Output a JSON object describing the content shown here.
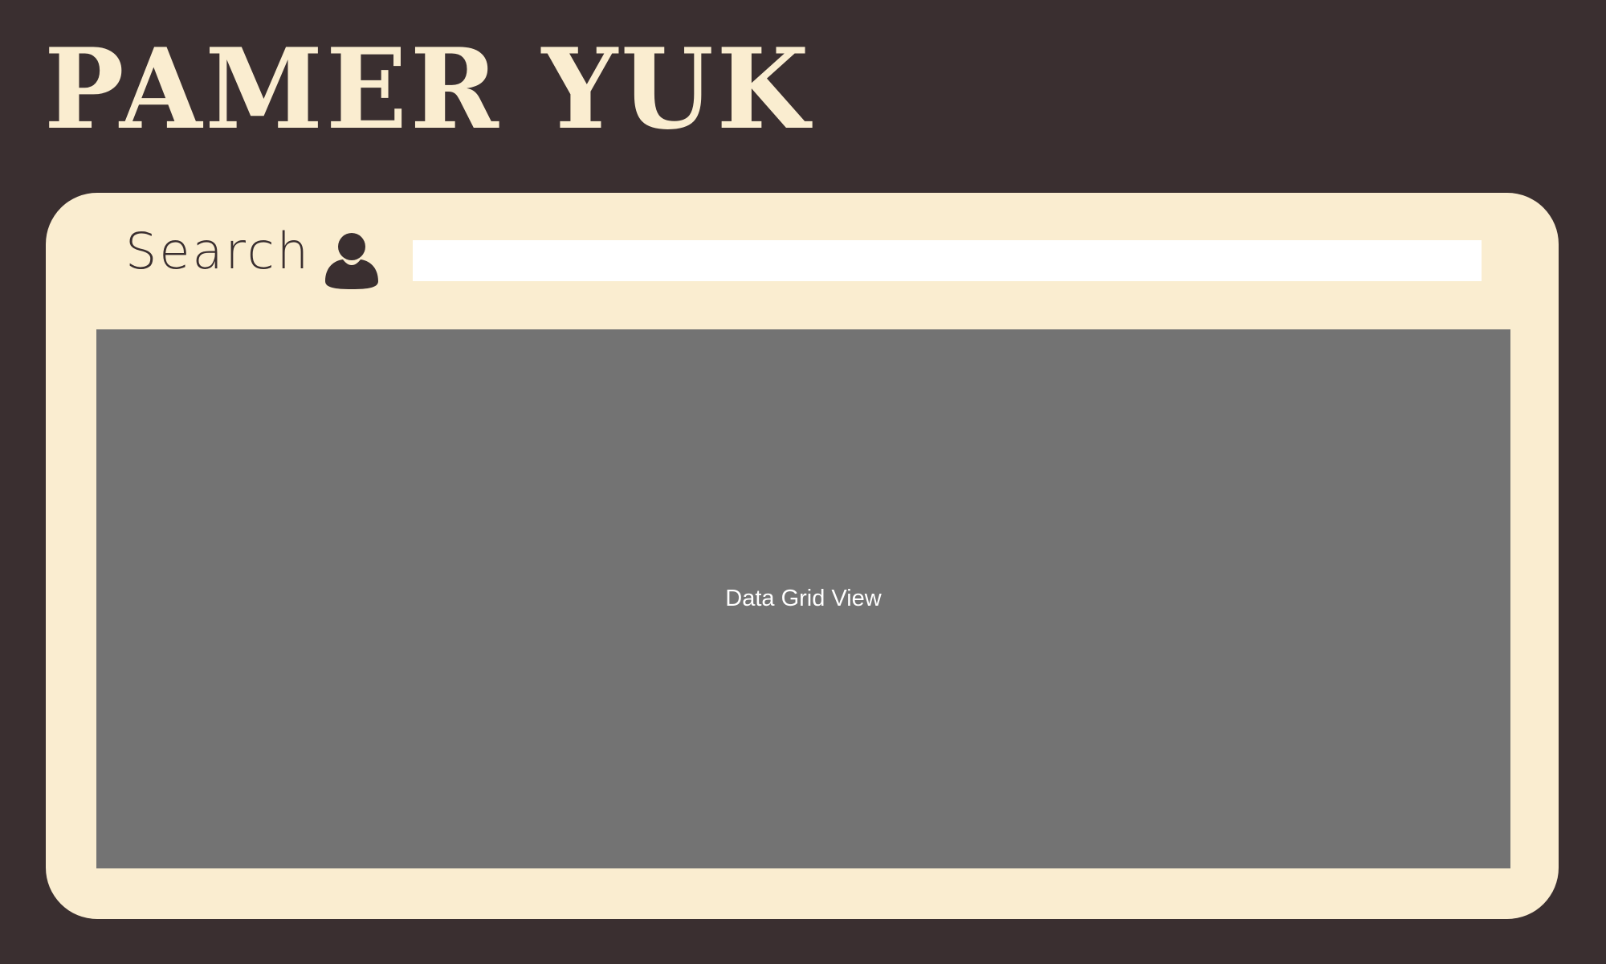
{
  "colors": {
    "background": "#3a2f30",
    "panel": "#faedd0",
    "title": "#faedd0",
    "grid": "#737373",
    "grid_text": "#ffffff",
    "input": "#ffffff"
  },
  "header": {
    "title": "PAMER YUK"
  },
  "search": {
    "label": "Search",
    "icon": "user-icon",
    "value": ""
  },
  "data_grid": {
    "label": "Data Grid View"
  }
}
